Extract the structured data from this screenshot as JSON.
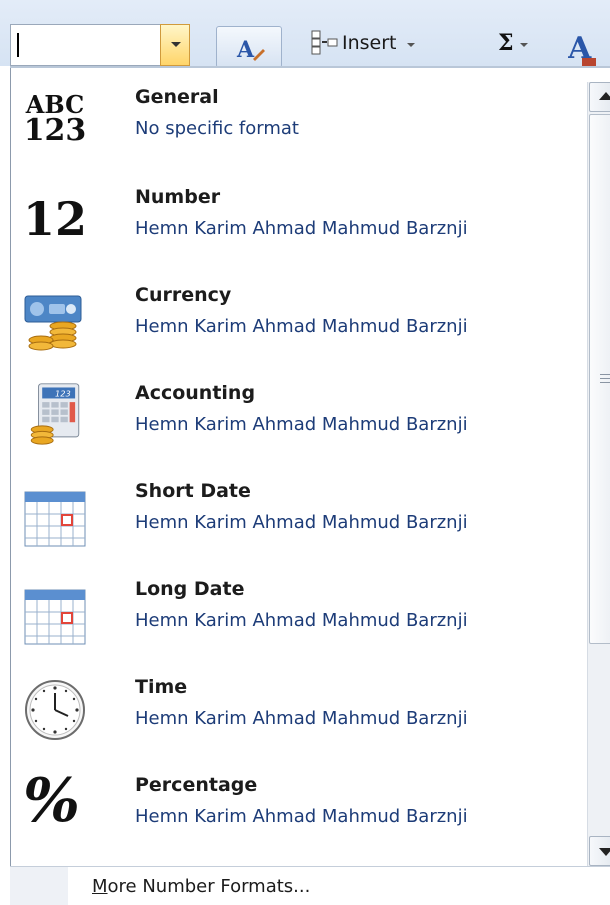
{
  "ribbon": {
    "number_format_value": "",
    "insert_label": "Insert",
    "sum_symbol": "Σ"
  },
  "format_items": [
    {
      "title": "General",
      "subtitle": "No specific format",
      "icon": "abc-123-icon"
    },
    {
      "title": "Number",
      "subtitle": "Hemn Karim Ahmad Mahmud Barznji",
      "icon": "number-12-icon"
    },
    {
      "title": "Currency",
      "subtitle": "Hemn Karim Ahmad Mahmud Barznji",
      "icon": "currency-icon"
    },
    {
      "title": "Accounting",
      "subtitle": " Hemn Karim Ahmad Mahmud Barznji",
      "icon": "accounting-icon"
    },
    {
      "title": "Short Date",
      "subtitle": "Hemn Karim Ahmad Mahmud Barznji",
      "icon": "calendar-icon"
    },
    {
      "title": "Long Date",
      "subtitle": "Hemn Karim Ahmad Mahmud Barznji",
      "icon": "calendar-icon"
    },
    {
      "title": "Time",
      "subtitle": "Hemn Karim Ahmad Mahmud Barznji",
      "icon": "clock-icon"
    },
    {
      "title": "Percentage",
      "subtitle": "Hemn Karim Ahmad Mahmud Barznji",
      "icon": "percent-icon"
    }
  ],
  "icon_text": {
    "general_top": "ABC",
    "general_bottom": "123",
    "number": "12",
    "percent": "%"
  },
  "footer": {
    "more_accel": "M",
    "more_rest": "ore Number Formats..."
  },
  "colors": {
    "subtitle": "#1d3c78",
    "ribbon": "#d6e3f3",
    "highlight": "#ffd56a"
  }
}
